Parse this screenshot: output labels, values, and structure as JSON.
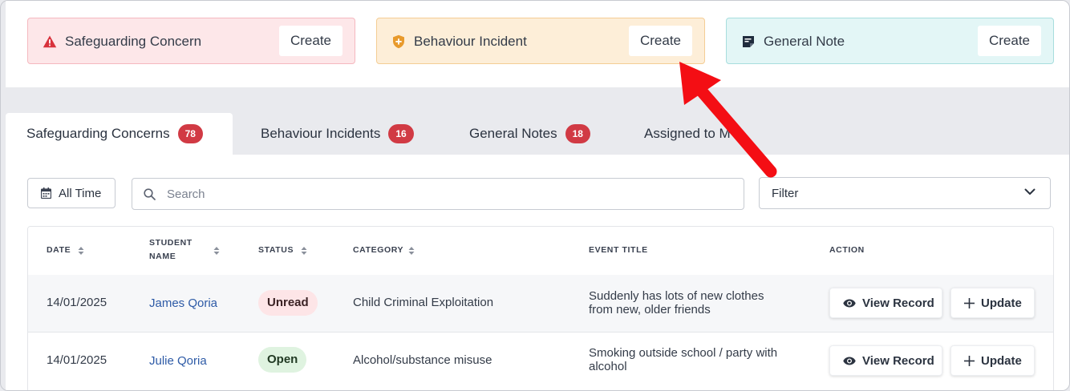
{
  "cards": [
    {
      "label": "Safeguarding Concern",
      "create": "Create",
      "icon": "warning-triangle-icon",
      "color": "#d8323c"
    },
    {
      "label": "Behaviour Incident",
      "create": "Create",
      "icon": "shield-plus-icon",
      "color": "#e89a2c"
    },
    {
      "label": "General Note",
      "create": "Create",
      "icon": "note-icon",
      "color": "#1f2c3d"
    }
  ],
  "tabs": [
    {
      "label": "Safeguarding Concerns",
      "count": "78",
      "active": true
    },
    {
      "label": "Behaviour Incidents",
      "count": "16",
      "active": false
    },
    {
      "label": "General Notes",
      "count": "18",
      "active": false
    },
    {
      "label": "Assigned to M",
      "count": "",
      "active": false
    }
  ],
  "toolbar": {
    "alltime_label": "All Time",
    "search_placeholder": "Search",
    "filter_label": "Filter"
  },
  "table": {
    "headers": {
      "date": "DATE",
      "student_name_1": "STUDENT",
      "student_name_2": "NAME",
      "status": "STATUS",
      "category": "CATEGORY",
      "event_title": "EVENT TITLE",
      "action": "ACTION"
    },
    "rows": [
      {
        "date": "14/01/2025",
        "student": "James Qoria",
        "status": "Unread",
        "category": "Child Criminal Exploitation",
        "title_1": "Suddenly has lots of new clothes",
        "title_2": "from new, older friends",
        "view": "View Record",
        "update": "Update"
      },
      {
        "date": "14/01/2025",
        "student": "Julie Qoria",
        "status": "Open",
        "category": "Alcohol/substance misuse",
        "title_1": "Smoking outside school / party with",
        "title_2": "alcohol",
        "view": "View Record",
        "update": "Update"
      }
    ]
  },
  "colors": {
    "badge": "#d13a44",
    "annotation_arrow": "#f40e14",
    "link": "#2d5aa6"
  }
}
